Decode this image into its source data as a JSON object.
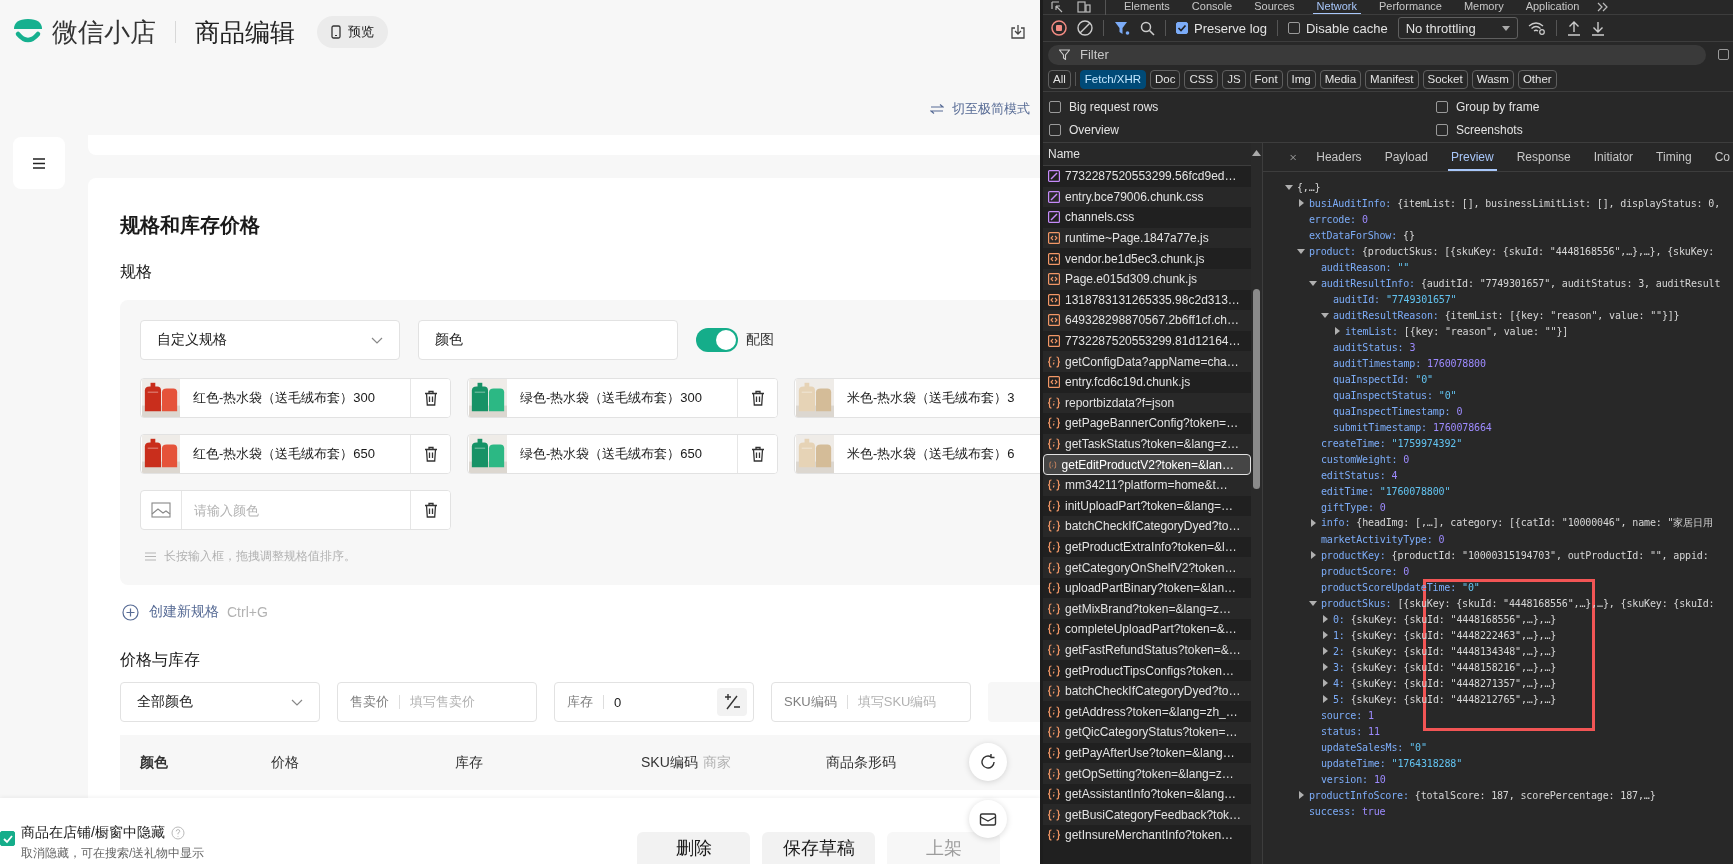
{
  "app": {
    "brand": "微信小店",
    "page_title": "商品编辑",
    "preview_button": "预览",
    "mode_switch": "切至极简模式",
    "section_title": "规格和库存价格",
    "spec_label": "规格",
    "spec": {
      "type_select": "自定义规格",
      "name_value": "颜色",
      "image_toggle": {
        "label": "配图",
        "on": true
      },
      "values": [
        {
          "text": "红色-热水袋（送毛绒布套）300",
          "kind": "picture"
        },
        {
          "text": "绿色-热水袋（送毛绒布套）300",
          "kind": "picture"
        },
        {
          "text": "米色-热水袋（送毛绒布套）3",
          "kind": "picture"
        },
        {
          "text": "红色-热水袋（送毛绒布套）650",
          "kind": "picture"
        },
        {
          "text": "绿色-热水袋（送毛绒布套）650",
          "kind": "picture"
        },
        {
          "text": "米色-热水袋（送毛绒布套）6",
          "kind": "picture"
        }
      ],
      "new_value_placeholder": "请输入颜色",
      "hint": "长按输入框，拖拽调整规格值排序。"
    },
    "add_spec": {
      "label": "创建新规格",
      "shortcut": "Ctrl+G"
    },
    "price_stock_label": "价格与库存",
    "batch": {
      "color_select": "全部颜色",
      "price": {
        "label": "售卖价",
        "placeholder": "填写售卖价"
      },
      "stock": {
        "label": "库存",
        "value": "0"
      },
      "sku": {
        "label": "SKU编码",
        "placeholder": "填写SKU编码"
      }
    },
    "table": {
      "columns": [
        {
          "label": "颜色"
        },
        {
          "label": "价格"
        },
        {
          "label": "库存"
        },
        {
          "label": "SKU编码",
          "note": "商家"
        },
        {
          "label": "商品条形码"
        }
      ]
    },
    "footer": {
      "hide": {
        "label": "商品在店铺/橱窗中隐藏",
        "checked": true,
        "sub": "取消隐藏，可在搜索/送礼物中显示"
      },
      "buttons": [
        {
          "label": "删除",
          "disabled": false
        },
        {
          "label": "保存草稿",
          "disabled": false
        },
        {
          "label": "上架",
          "disabled": true
        }
      ]
    }
  },
  "devtools": {
    "panels": [
      {
        "label": "Elements",
        "selected": false
      },
      {
        "label": "Console",
        "selected": false
      },
      {
        "label": "Sources",
        "selected": false
      },
      {
        "label": "Network",
        "selected": true
      },
      {
        "label": "Performance",
        "selected": false
      },
      {
        "label": "Memory",
        "selected": false
      },
      {
        "label": "Application",
        "selected": false
      }
    ],
    "toolbar": {
      "preserve_log": {
        "label": "Preserve log",
        "checked": true
      },
      "disable_cache": {
        "label": "Disable cache",
        "checked": false
      },
      "throttling": "No throttling"
    },
    "filter": {
      "placeholder": "Filter",
      "side_checkbox": {
        "checked": false
      }
    },
    "types": [
      {
        "label": "All",
        "selected": false
      },
      {
        "label": "Fetch/XHR",
        "selected": true
      },
      {
        "label": "Doc",
        "selected": false
      },
      {
        "label": "CSS",
        "selected": false
      },
      {
        "label": "JS",
        "selected": false
      },
      {
        "label": "Font",
        "selected": false
      },
      {
        "label": "Img",
        "selected": false
      },
      {
        "label": "Media",
        "selected": false
      },
      {
        "label": "Manifest",
        "selected": false
      },
      {
        "label": "Socket",
        "selected": false
      },
      {
        "label": "Wasm",
        "selected": false
      },
      {
        "label": "Other",
        "selected": false
      }
    ],
    "options": [
      {
        "label": "Big request rows",
        "checked": false
      },
      {
        "label": "Group by frame",
        "checked": false
      },
      {
        "label": "Overview",
        "checked": false
      },
      {
        "label": "Screenshots",
        "checked": false
      }
    ],
    "requests": {
      "header": "Name",
      "rows": [
        {
          "name": "7732287520553299.56fcd9ed…",
          "kind": "css",
          "selected": false
        },
        {
          "name": "entry.bce79006.chunk.css",
          "kind": "css",
          "selected": false
        },
        {
          "name": "channels.css",
          "kind": "css",
          "selected": false
        },
        {
          "name": "runtime~Page.1847a77e.js",
          "kind": "script",
          "selected": false
        },
        {
          "name": "vendor.be1d5ec3.chunk.js",
          "kind": "script",
          "selected": false
        },
        {
          "name": "Page.e015d309.chunk.js",
          "kind": "script",
          "selected": false
        },
        {
          "name": "1318783131265335.98c2d313…",
          "kind": "script",
          "selected": false
        },
        {
          "name": "649328298870567.2b6ff1cf.ch…",
          "kind": "script",
          "selected": false
        },
        {
          "name": "7732287520553299.81d12164…",
          "kind": "script",
          "selected": false
        },
        {
          "name": "getConfigData?appName=cha…",
          "kind": "fetch",
          "selected": false
        },
        {
          "name": "entry.fcd6c19d.chunk.js",
          "kind": "script",
          "selected": false
        },
        {
          "name": "reportbizdata?f=json",
          "kind": "fetch",
          "selected": false
        },
        {
          "name": "getPageBannerConfig?token=…",
          "kind": "fetch",
          "selected": false
        },
        {
          "name": "getTaskStatus?token=&lang=z…",
          "kind": "fetch",
          "selected": false
        },
        {
          "name": "getEditProductV2?token=&lan…",
          "kind": "fetch",
          "selected": true
        },
        {
          "name": "mm34211?platform=home&t…",
          "kind": "fetch",
          "selected": false
        },
        {
          "name": "initUploadPart?token=&lang=…",
          "kind": "fetch",
          "selected": false
        },
        {
          "name": "batchCheckIfCategoryDyed?to…",
          "kind": "fetch",
          "selected": false
        },
        {
          "name": "getProductExtraInfo?token=&l…",
          "kind": "fetch",
          "selected": false
        },
        {
          "name": "getCategoryOnShelfV2?token…",
          "kind": "fetch",
          "selected": false
        },
        {
          "name": "uploadPartBinary?token=&lan…",
          "kind": "fetch",
          "selected": false
        },
        {
          "name": "getMixBrand?token=&lang=z…",
          "kind": "fetch",
          "selected": false
        },
        {
          "name": "completeUploadPart?token=&…",
          "kind": "fetch",
          "selected": false
        },
        {
          "name": "getFastRefundStatus?token=&…",
          "kind": "fetch",
          "selected": false
        },
        {
          "name": "getProductTipsConfigs?token…",
          "kind": "fetch",
          "selected": false
        },
        {
          "name": "batchCheckIfCategoryDyed?to…",
          "kind": "fetch",
          "selected": false
        },
        {
          "name": "getAddress?token=&lang=zh_…",
          "kind": "fetch",
          "selected": false
        },
        {
          "name": "getQicCategoryStatus?token=…",
          "kind": "fetch",
          "selected": false
        },
        {
          "name": "getPayAfterUse?token=&lang…",
          "kind": "fetch",
          "selected": false
        },
        {
          "name": "getOpSetting?token=&lang=z…",
          "kind": "fetch",
          "selected": false
        },
        {
          "name": "getAssistantInfo?token=&lang…",
          "kind": "fetch",
          "selected": false
        },
        {
          "name": "getBusiCategoryFeedback?tok…",
          "kind": "fetch",
          "selected": false
        },
        {
          "name": "getInsureMerchantInfo?token…",
          "kind": "fetch",
          "selected": false
        }
      ]
    },
    "detail": {
      "tabs": [
        {
          "label": "Headers",
          "selected": false
        },
        {
          "label": "Payload",
          "selected": false
        },
        {
          "label": "Preview",
          "selected": true
        },
        {
          "label": "Response",
          "selected": false
        },
        {
          "label": "Initiator",
          "selected": false
        },
        {
          "label": "Timing",
          "selected": false
        },
        {
          "label": "Co",
          "selected": false
        }
      ],
      "tree": {
        "value": "{,…}",
        "kind": "object",
        "expanded": true,
        "children": [
          {
            "key": "busiAuditInfo:",
            "value": "{itemList: [], businessLimitList: [], displayStatus: 0,",
            "kind": "object",
            "expanded": false
          },
          {
            "key": "errcode:",
            "value": "0",
            "kind": "number"
          },
          {
            "key": "extDataForShow:",
            "value": "{}",
            "kind": "object"
          },
          {
            "key": "product:",
            "value": "{productSkus: [{skuKey: {skuId: \"4448168556\",…},…}, {skuKey:",
            "kind": "object",
            "expanded": true,
            "children": [
              {
                "key": "auditReason:",
                "value": "\"\"",
                "kind": "string"
              },
              {
                "key": "auditResultInfo:",
                "value": "{auditId: \"7749301657\", auditStatus: 3, auditResult",
                "kind": "object",
                "expanded": true,
                "children": [
                  {
                    "key": "auditId:",
                    "value": "\"7749301657\"",
                    "kind": "string"
                  },
                  {
                    "key": "auditResultReason:",
                    "value": "{itemList: [{key: \"reason\", value: \"\"}]}",
                    "kind": "object",
                    "expanded": true,
                    "children": [
                      {
                        "key": "itemList:",
                        "value": "[{key: \"reason\", value: \"\"}]",
                        "kind": "object",
                        "expanded": false
                      }
                    ]
                  },
                  {
                    "key": "auditStatus:",
                    "value": "3",
                    "kind": "number"
                  },
                  {
                    "key": "auditTimestamp:",
                    "value": "1760078800",
                    "kind": "number"
                  },
                  {
                    "key": "quaInspectId:",
                    "value": "\"0\"",
                    "kind": "string"
                  },
                  {
                    "key": "quaInspectStatus:",
                    "value": "\"0\"",
                    "kind": "string"
                  },
                  {
                    "key": "quaInspectTimestamp:",
                    "value": "0",
                    "kind": "number"
                  },
                  {
                    "key": "submitTimestamp:",
                    "value": "1760078664",
                    "kind": "number"
                  }
                ]
              },
              {
                "key": "createTime:",
                "value": "\"1759974392\"",
                "kind": "string"
              },
              {
                "key": "customWeight:",
                "value": "0",
                "kind": "number"
              },
              {
                "key": "editStatus:",
                "value": "4",
                "kind": "number"
              },
              {
                "key": "editTime:",
                "value": "\"1760078800\"",
                "kind": "string"
              },
              {
                "key": "giftType:",
                "value": "0",
                "kind": "number"
              },
              {
                "key": "info:",
                "value": "{headImg: [,…], category: [{catId: \"10000046\", name: \"家居日用",
                "kind": "object",
                "expanded": false
              },
              {
                "key": "marketActivityType:",
                "value": "0",
                "kind": "number"
              },
              {
                "key": "productKey:",
                "value": "{productId: \"10000315194703\", outProductId: \"\", appid:",
                "kind": "object",
                "expanded": false
              },
              {
                "key": "productScore:",
                "value": "0",
                "kind": "number"
              },
              {
                "key": "productScoreUpdateTime:",
                "value": "\"0\"",
                "kind": "string"
              },
              {
                "key": "productSkus:",
                "value": "[{skuKey: {skuId: \"4448168556\",…},…}, {skuKey: {skuId:",
                "kind": "object",
                "expanded": true,
                "children": [
                  {
                    "key": "0:",
                    "value": "{skuKey: {skuId: \"4448168556\",…},…}",
                    "kind": "object",
                    "expanded": false
                  },
                  {
                    "key": "1:",
                    "value": "{skuKey: {skuId: \"4448222463\",…},…}",
                    "kind": "object",
                    "expanded": false
                  },
                  {
                    "key": "2:",
                    "value": "{skuKey: {skuId: \"4448134348\",…},…}",
                    "kind": "object",
                    "expanded": false
                  },
                  {
                    "key": "3:",
                    "value": "{skuKey: {skuId: \"4448158216\",…},…}",
                    "kind": "object",
                    "expanded": false
                  },
                  {
                    "key": "4:",
                    "value": "{skuKey: {skuId: \"4448271357\",…},…}",
                    "kind": "object",
                    "expanded": false
                  },
                  {
                    "key": "5:",
                    "value": "{skuKey: {skuId: \"4448212765\",…},…}",
                    "kind": "object",
                    "expanded": false
                  }
                ]
              },
              {
                "key": "source:",
                "value": "1",
                "kind": "number"
              },
              {
                "key": "status:",
                "value": "11",
                "kind": "number"
              },
              {
                "key": "updateSalesMs:",
                "value": "\"0\"",
                "kind": "string"
              },
              {
                "key": "updateTime:",
                "value": "\"1764318288\"",
                "kind": "string"
              },
              {
                "key": "version:",
                "value": "10",
                "kind": "number"
              }
            ]
          },
          {
            "key": "productInfoScore:",
            "value": "{totalScore: 187, scorePercentage: 187,…}",
            "kind": "object",
            "expanded": false
          },
          {
            "key": "success:",
            "value": "true",
            "kind": "boolean"
          }
        ]
      }
    }
  }
}
